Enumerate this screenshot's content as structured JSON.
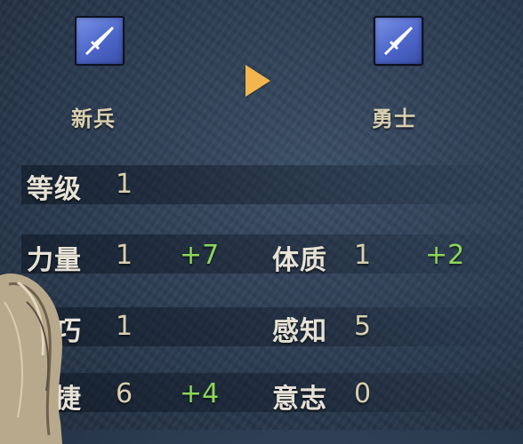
{
  "classes": {
    "from": {
      "label": "新兵",
      "icon": "sword-icon"
    },
    "to": {
      "label": "勇士",
      "icon": "sword-icon"
    }
  },
  "arrow_icon": "play-arrow-icon",
  "colors": {
    "name": "#e6e2d6",
    "value": "#d8cfae",
    "bonus": "#8cd65a",
    "arrow": "#f2b64f",
    "icon_bg": "#5a74d6"
  },
  "level": {
    "label": "等级",
    "value": "1"
  },
  "stats": {
    "strength": {
      "label": "力量",
      "value": "1",
      "bonus": "+7"
    },
    "constitution": {
      "label": "体质",
      "value": "1",
      "bonus": "+2"
    },
    "skill": {
      "label": "技巧",
      "value": "1",
      "bonus": ""
    },
    "perception": {
      "label": "感知",
      "value": "5",
      "bonus": ""
    },
    "agility": {
      "label": "敏捷",
      "value": "6",
      "bonus": "+4"
    },
    "will": {
      "label": "意志",
      "value": "0",
      "bonus": ""
    }
  }
}
